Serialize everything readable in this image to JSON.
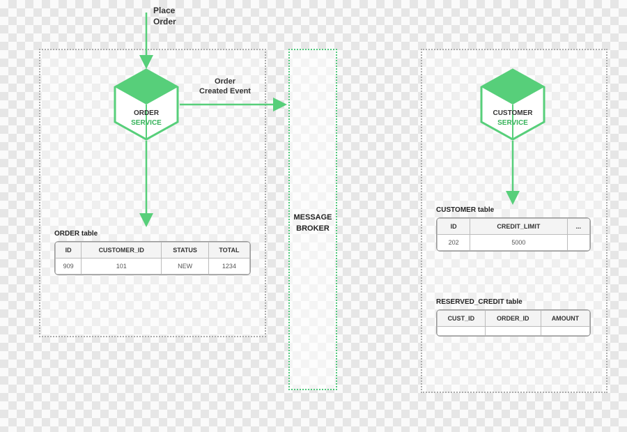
{
  "flow": {
    "input_label": "Place\nOrder",
    "event_label": "Order\nCreated Event",
    "broker_label": "MESSAGE\nBROKER"
  },
  "order_service": {
    "name": "ORDER",
    "sub": "SERVICE",
    "table_title": "ORDER table",
    "columns": [
      "ID",
      "CUSTOMER_ID",
      "STATUS",
      "TOTAL"
    ],
    "rows": [
      [
        "909",
        "101",
        "NEW",
        "1234"
      ]
    ]
  },
  "customer_service": {
    "name": "CUSTOMER",
    "sub": "SERVICE",
    "table_title": "CUSTOMER table",
    "columns": [
      "ID",
      "CREDIT_LIMIT",
      "..."
    ],
    "rows": [
      [
        "202",
        "5000",
        ""
      ]
    ],
    "reserved_title": "RESERVED_CREDIT table",
    "reserved_columns": [
      "CUST_ID",
      "ORDER_ID",
      "AMOUNT"
    ],
    "reserved_rows": [
      [
        "",
        "",
        ""
      ]
    ]
  },
  "colors": {
    "green": "#57cf7a",
    "green_dark": "#36b25a"
  }
}
